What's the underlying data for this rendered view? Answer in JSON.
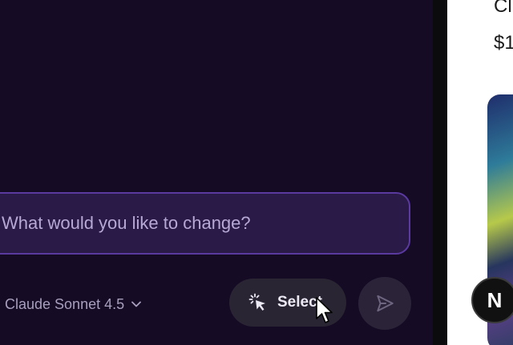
{
  "chat": {
    "input_text": "What would you like to change?",
    "model_label": "Claude Sonnet 4.5",
    "select_label": "Select"
  },
  "preview": {
    "title": "Cl",
    "price": "$1"
  },
  "badge": {
    "label": "N"
  },
  "icons": [
    "select-element-icon",
    "chevron-down-icon",
    "send-icon",
    "mouse-pointer-icon"
  ],
  "colors": {
    "background": "#150b25",
    "input_border": "#5b3aa0",
    "input_fill": "#2a1a47",
    "button_fill": "#2a2533"
  }
}
